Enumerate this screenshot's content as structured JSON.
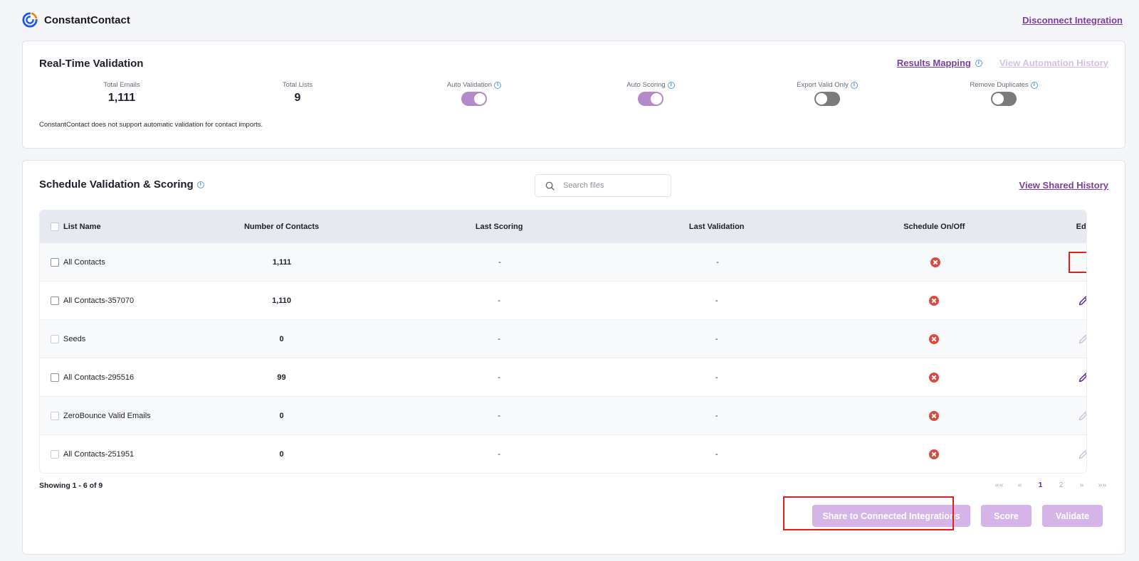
{
  "header": {
    "brand": "ConstantContact",
    "disconnect_label": "Disconnect Integration"
  },
  "realtime": {
    "title": "Real-Time Validation",
    "results_mapping": "Results Mapping",
    "view_automation_history": "View Automation History",
    "total_emails_label": "Total Emails",
    "total_emails_value": "1,111",
    "total_lists_label": "Total Lists",
    "total_lists_value": "9",
    "auto_validation_label": "Auto Validation",
    "auto_validation_on": true,
    "auto_scoring_label": "Auto Scoring",
    "auto_scoring_on": true,
    "export_valid_only_label": "Export Valid Only",
    "export_valid_only_on": false,
    "remove_duplicates_label": "Remove Duplicates",
    "remove_duplicates_on": false,
    "note": "ConstantContact does not support automatic validation for contact imports."
  },
  "schedule": {
    "title": "Schedule Validation & Scoring",
    "search_placeholder": "Search files",
    "view_shared_history": "View Shared History",
    "columns": {
      "list_name": "List Name",
      "number_of_contacts": "Number of Contacts",
      "last_scoring": "Last Scoring",
      "last_validation": "Last Validation",
      "schedule": "Schedule On/Off",
      "edit": "Edit"
    },
    "rows": [
      {
        "name": "All Contacts",
        "contacts": "1,111",
        "last_scoring": "-",
        "last_validation": "-",
        "editable": true
      },
      {
        "name": "All Contacts-357070",
        "contacts": "1,110",
        "last_scoring": "-",
        "last_validation": "-",
        "editable": true
      },
      {
        "name": "Seeds",
        "contacts": "0",
        "last_scoring": "-",
        "last_validation": "-",
        "editable": false
      },
      {
        "name": "All Contacts-295516",
        "contacts": "99",
        "last_scoring": "-",
        "last_validation": "-",
        "editable": true
      },
      {
        "name": "ZeroBounce Valid Emails",
        "contacts": "0",
        "last_scoring": "-",
        "last_validation": "-",
        "editable": false
      },
      {
        "name": "All Contacts-251951",
        "contacts": "0",
        "last_scoring": "-",
        "last_validation": "-",
        "editable": false
      }
    ],
    "showing": "Showing 1 - 6 of 9",
    "pager": {
      "first": "««",
      "prev": "«",
      "page1": "1",
      "page2": "2",
      "next": "»",
      "last": "»»"
    },
    "share_label": "Share to Connected Integrations",
    "score_label": "Score",
    "validate_label": "Validate"
  },
  "colors": {
    "accent": "#7b3fa0",
    "button_disabled": "#d5b4e7",
    "schedule_off": "#dc4a3f",
    "edit_enabled": "#5c2d91",
    "edit_disabled": "#d2bfe2"
  }
}
